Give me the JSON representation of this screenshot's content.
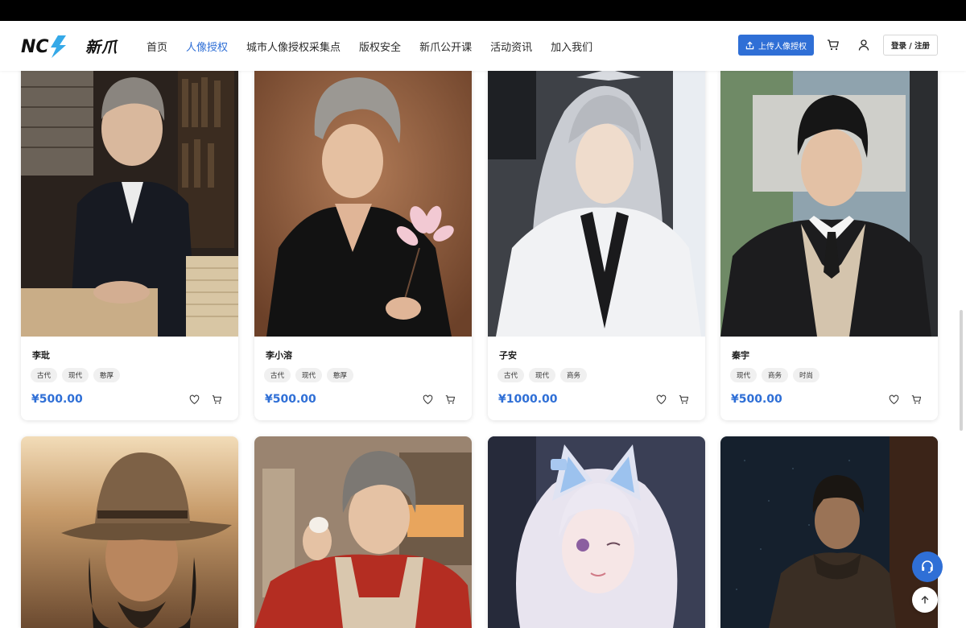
{
  "header": {
    "logo_mark": "NC",
    "logo_text": "新爪",
    "nav": [
      {
        "label": "首页",
        "active": false
      },
      {
        "label": "人像授权",
        "active": true
      },
      {
        "label": "城市人像授权采集点",
        "active": false
      },
      {
        "label": "版权安全",
        "active": false
      },
      {
        "label": "新爪公开课",
        "active": false
      },
      {
        "label": "活动资讯",
        "active": false
      },
      {
        "label": "加入我们",
        "active": false
      }
    ],
    "upload_label": "上传人像授权",
    "login_label": "登录 / 注册"
  },
  "cards": [
    {
      "name": "李玭",
      "tags": [
        "古代",
        "现代",
        "憨厚"
      ],
      "price": "¥500.00"
    },
    {
      "name": "李小溶",
      "tags": [
        "古代",
        "现代",
        "憨厚"
      ],
      "price": "¥500.00"
    },
    {
      "name": "子安",
      "tags": [
        "古代",
        "现代",
        "商务"
      ],
      "price": "¥1000.00"
    },
    {
      "name": "秦宇",
      "tags": [
        "现代",
        "商务",
        "时尚"
      ],
      "price": "¥500.00"
    }
  ],
  "icons": {
    "upload": "upload-icon",
    "cart": "cart-icon",
    "user": "user-icon",
    "heart": "heart-icon",
    "headset": "headset-icon",
    "back_to_top": "arrow-up-icon"
  },
  "colors": {
    "accent": "#2f6fd6",
    "tag_bg": "#f0f0f0"
  }
}
